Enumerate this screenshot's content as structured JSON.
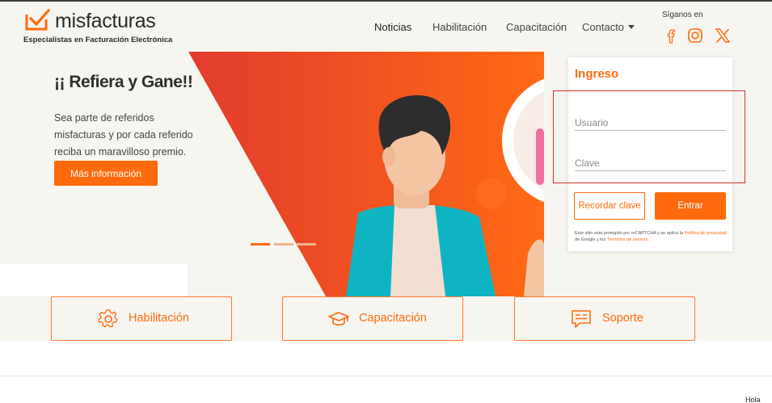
{
  "brand": {
    "name": "misfacturas",
    "tagline": "Especialistas en Facturación Electrónica",
    "accent": "#ff6a0c",
    "highlight": "#d0312d"
  },
  "nav": {
    "items": [
      {
        "label": "Noticias",
        "active": true
      },
      {
        "label": "Habilitación"
      },
      {
        "label": "Capacitación"
      },
      {
        "label": "Contacto",
        "has_dropdown": true
      }
    ]
  },
  "social": {
    "label": "Síganos en",
    "icons": [
      "facebook-icon",
      "instagram-icon",
      "x-icon"
    ]
  },
  "hero": {
    "title": "¡¡ Refiera y Gane!!",
    "lines": [
      "Sea parte de referidos",
      "misfacturas y por cada referido",
      "reciba un maravilloso premio."
    ],
    "button_label": "Más información",
    "slides": {
      "count": 3,
      "active": 1
    }
  },
  "login": {
    "title": "Ingreso",
    "user_placeholder": "Usuario",
    "pass_placeholder": "Clave",
    "forgot_label": "Recordar clave",
    "submit_label": "Entrar",
    "captcha_prefix": "Este sitio está protegido por reCAPTCHA y se aplica la",
    "privacy_link": "Política de privacidad",
    "captcha_middle": "de Google y los",
    "terms_link": "Términos de servicio",
    "captcha_suffix": "."
  },
  "features": [
    {
      "label": "Habilitación",
      "icon": "gear-icon"
    },
    {
      "label": "Capacitación",
      "icon": "graduation-cap-icon"
    },
    {
      "label": "Soporte",
      "icon": "chat-icon"
    }
  ],
  "chat": {
    "label": "Hola"
  }
}
